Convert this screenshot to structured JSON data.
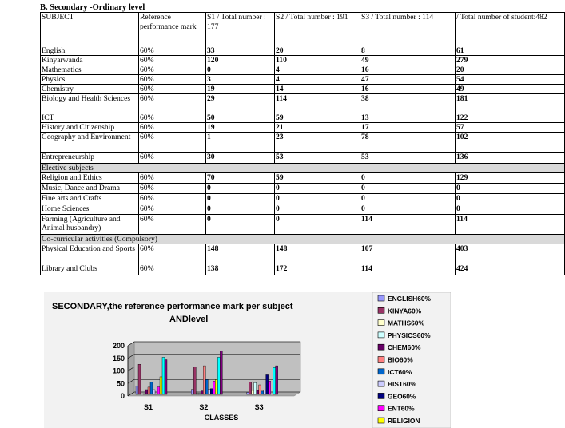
{
  "table": {
    "caption": "B. Secondary -Ordinary level",
    "headers": [
      "SUBJECT",
      "Reference performance mark",
      "S1  / Total number : 177",
      "S2  / Total number : 191",
      "S3  / Total number : 114",
      "/ Total number of student:482"
    ],
    "rows": [
      {
        "kind": "data",
        "cells": [
          "English",
          "60%",
          "33",
          "20",
          "8",
          "61"
        ]
      },
      {
        "kind": "data",
        "cells": [
          "Kinyarwanda",
          "60%",
          "120",
          "110",
          "49",
          "279"
        ]
      },
      {
        "kind": "data",
        "cells": [
          "Mathematics",
          "60%",
          "0",
          "4",
          "16",
          "20"
        ]
      },
      {
        "kind": "data",
        "cells": [
          "Physics",
          "60%",
          "3",
          "4",
          "47",
          "54"
        ]
      },
      {
        "kind": "data",
        "cells": [
          "Chemistry",
          "60%",
          "19",
          "14",
          "16",
          "49"
        ]
      },
      {
        "kind": "data",
        "cells": [
          "Biology and Health Sciences",
          "60%",
          "29",
          "114",
          "38",
          "181"
        ]
      },
      {
        "kind": "data",
        "cells": [
          "ICT",
          "60%",
          "50",
          "59",
          "13",
          "122"
        ]
      },
      {
        "kind": "data",
        "cells": [
          "History and Citizenship",
          "60%",
          "19",
          "21",
          "17",
          "57"
        ]
      },
      {
        "kind": "data",
        "cells": [
          "Geography and Environment",
          "60%",
          "1",
          "23",
          "78",
          "102"
        ]
      },
      {
        "kind": "data",
        "cells": [
          "Entrepreneurship",
          "60%",
          "30",
          "53",
          "53",
          "136"
        ]
      },
      {
        "kind": "section",
        "label": "Elective subjects"
      },
      {
        "kind": "data",
        "cells": [
          "Religion and Ethics",
          "60%",
          "70",
          "59",
          "0",
          "129"
        ]
      },
      {
        "kind": "data",
        "cells": [
          "Music, Dance and Drama",
          "60%",
          "0",
          "0",
          "0",
          "0"
        ]
      },
      {
        "kind": "data",
        "cells": [
          "Fine arts and Crafts",
          "60%",
          "0",
          "0",
          "0",
          "0"
        ]
      },
      {
        "kind": "data",
        "cells": [
          "Home Sciences",
          "60%",
          "0",
          "0",
          "0",
          "0"
        ]
      },
      {
        "kind": "data",
        "cells": [
          "Farming (Agriculture and Animal husbandry)",
          "60%",
          "0",
          "0",
          "114",
          "114"
        ]
      },
      {
        "kind": "section",
        "label": "Co-curricular activities (Compulsory)"
      },
      {
        "kind": "data",
        "cells": [
          "Physical Education and Sports",
          "60%",
          "148",
          "148",
          "107",
          "403"
        ]
      },
      {
        "kind": "data",
        "cells": [
          "Library and Clubs",
          "60%",
          "138",
          "172",
          "114",
          "424"
        ]
      }
    ]
  },
  "chart_data": {
    "type": "bar",
    "title": "SECONDARY,the reference performance mark per subject ANDlevel",
    "xlabel": "CLASSES",
    "ylabel": "",
    "categories": [
      "S1",
      "S2",
      "S3"
    ],
    "ylim": [
      0,
      200
    ],
    "yticks": [
      0,
      50,
      100,
      150,
      200
    ],
    "grid": true,
    "legend_position": "right",
    "series": [
      {
        "name": "ENGLISH60%",
        "color": "#9999ff",
        "values": [
          33,
          20,
          8
        ]
      },
      {
        "name": "KINYA60%",
        "color": "#993366",
        "values": [
          120,
          110,
          49
        ]
      },
      {
        "name": "MATHS60%",
        "color": "#ffffcc",
        "values": [
          0,
          4,
          16
        ]
      },
      {
        "name": "PHYSICS60%",
        "color": "#ccffff",
        "values": [
          3,
          4,
          47
        ]
      },
      {
        "name": "CHEM60%",
        "color": "#660066",
        "values": [
          19,
          14,
          16
        ]
      },
      {
        "name": "BIO60%",
        "color": "#ff8080",
        "values": [
          29,
          114,
          38
        ]
      },
      {
        "name": "ICT60%",
        "color": "#0066cc",
        "values": [
          50,
          59,
          13
        ]
      },
      {
        "name": "HIST60%",
        "color": "#ccccff",
        "values": [
          19,
          21,
          17
        ]
      },
      {
        "name": "GEO60%",
        "color": "#000080",
        "values": [
          1,
          23,
          78
        ]
      },
      {
        "name": "ENT60%",
        "color": "#ff00ff",
        "values": [
          30,
          53,
          53
        ]
      },
      {
        "name": "RELIGION",
        "color": "#ffff00",
        "values": [
          70,
          59,
          0
        ]
      },
      {
        "name": "",
        "color": "#00ffff",
        "values": [
          148,
          148,
          107
        ]
      },
      {
        "name": "",
        "color": "#800080",
        "values": [
          138,
          172,
          114
        ]
      }
    ]
  }
}
